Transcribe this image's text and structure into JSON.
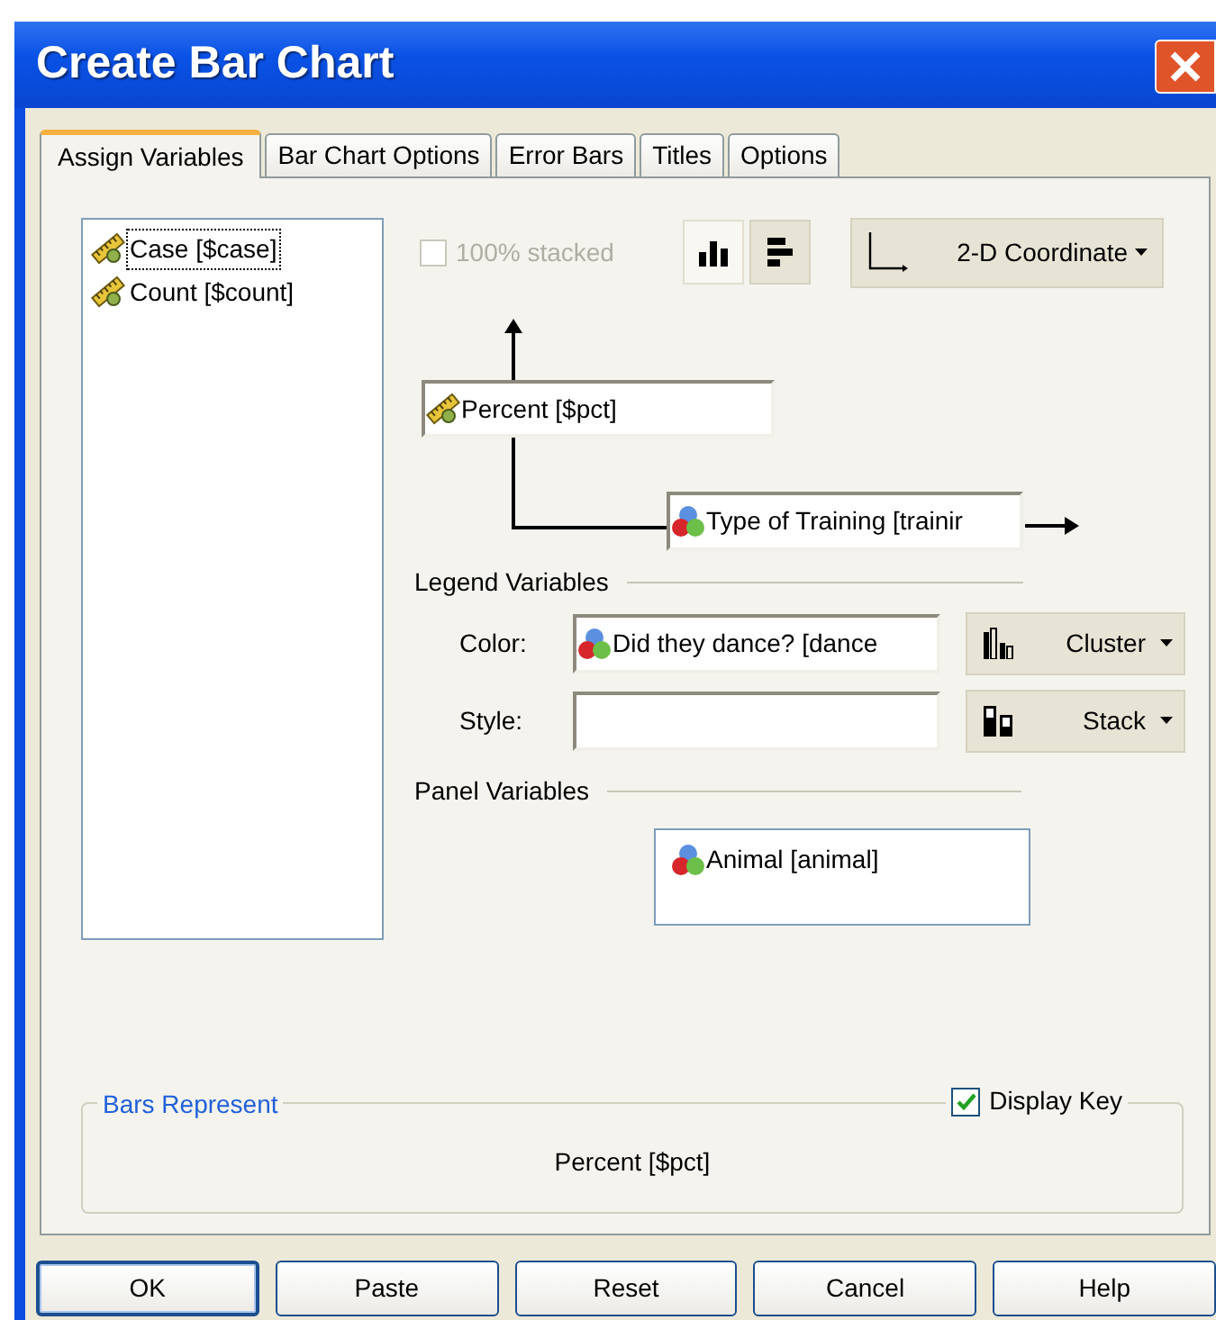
{
  "window": {
    "title": "Create Bar Chart"
  },
  "tabs": [
    {
      "label": "Assign Variables",
      "selected": true
    },
    {
      "label": "Bar Chart Options",
      "selected": false
    },
    {
      "label": "Error Bars",
      "selected": false
    },
    {
      "label": "Titles",
      "selected": false
    },
    {
      "label": "Options",
      "selected": false
    }
  ],
  "variables": [
    {
      "label": "Case [$case]",
      "kind": "scale",
      "selected": true
    },
    {
      "label": "Count [$count]",
      "kind": "scale",
      "selected": false
    }
  ],
  "stacked_checkbox": {
    "label": "100% stacked",
    "checked": false,
    "disabled": true
  },
  "orientation_buttons": [
    {
      "kind": "vertical",
      "selected": true
    },
    {
      "kind": "horizontal",
      "selected": false
    }
  ],
  "coordinate_button": {
    "label": "2-D Coordinate"
  },
  "y_axis": {
    "value": "Percent [$pct]",
    "kind": "scale"
  },
  "x_axis": {
    "value": "Type of Training [trainir",
    "kind": "nominal"
  },
  "legend_variables": {
    "heading": "Legend Variables",
    "rows": [
      {
        "label": "Color:",
        "field": {
          "value": "Did they dance? [dance",
          "kind": "nominal"
        },
        "mode": {
          "label": "Cluster",
          "kind": "cluster"
        }
      },
      {
        "label": "Style:",
        "mode": {
          "label": "Stack",
          "kind": "stack"
        }
      }
    ]
  },
  "panel_variables": {
    "heading": "Panel Variables",
    "items": [
      {
        "label": "Animal [animal]",
        "kind": "nominal"
      }
    ]
  },
  "bars_represent": {
    "heading": "Bars Represent",
    "value": "Percent [$pct]",
    "display_key": {
      "label": "Display Key",
      "checked": true
    }
  },
  "buttons": [
    {
      "label": "OK",
      "default": true
    },
    {
      "label": "Paste",
      "default": false
    },
    {
      "label": "Reset",
      "default": false
    },
    {
      "label": "Cancel",
      "default": false
    },
    {
      "label": "Help",
      "default": false
    }
  ]
}
